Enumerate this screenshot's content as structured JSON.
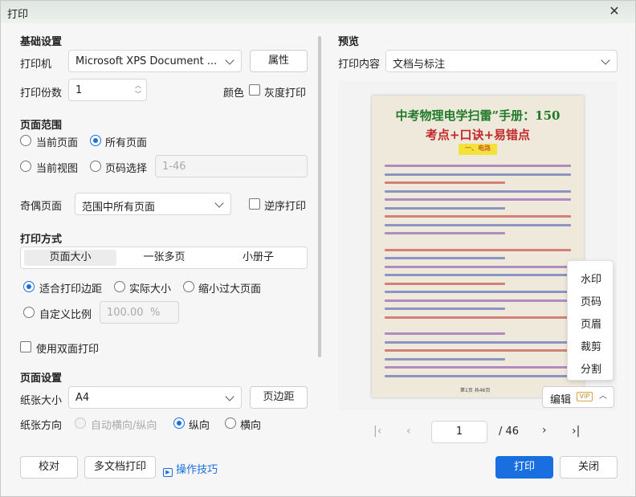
{
  "window": {
    "title": "打印",
    "close": "✕"
  },
  "basic": {
    "title": "基础设置",
    "printer_label": "打印机",
    "printer_value": "Microsoft XPS Document ...",
    "properties_btn": "属性",
    "copies_label": "打印份数",
    "copies_value": "1",
    "color_label": "颜色",
    "gray_label": "灰度打印"
  },
  "range": {
    "title": "页面范围",
    "current_page": "当前页面",
    "all_pages": "所有页面",
    "current_view": "当前视图",
    "page_select": "页码选择",
    "page_select_placeholder": "1-46",
    "odd_even_label": "奇偶页面",
    "odd_even_value": "范围中所有页面",
    "reverse_label": "逆序打印"
  },
  "mode": {
    "title": "打印方式",
    "tabs": [
      "页面大小",
      "一张多页",
      "小册子"
    ],
    "fit_margin": "适合打印边距",
    "actual_size": "实际大小",
    "shrink_large": "缩小过大页面",
    "custom_scale": "自定义比例",
    "scale_value": "100.00",
    "scale_unit": "%",
    "duplex": "使用双面打印"
  },
  "page_setup": {
    "title": "页面设置",
    "paper_size_label": "纸张大小",
    "paper_size_value": "A4",
    "margin_btn": "页边距",
    "orientation_label": "纸张方向",
    "auto_orientation": "自动横向/纵向",
    "portrait": "纵向",
    "landscape": "横向"
  },
  "footer": {
    "proof_btn": "校对",
    "multi_doc_btn": "多文档打印",
    "tips_link": "操作技巧",
    "print_btn": "打印",
    "close_btn": "关闭"
  },
  "preview": {
    "title": "预览",
    "content_label": "打印内容",
    "content_value": "文档与标注",
    "doc_title_line1": "中考物理电学扫雷”手册：150",
    "doc_title_line2": "考点+口诀+易错点",
    "doc_section": "一、电路",
    "doc_footer": "第1页 共46页",
    "edit_btn": "编辑",
    "vip_badge": "VIP",
    "menu_items": [
      "水印",
      "页码",
      "页眉",
      "裁剪",
      "分割"
    ],
    "current_page": "1",
    "total_pages": "/ 46"
  },
  "colors": {
    "accent": "#1a6fe0"
  }
}
